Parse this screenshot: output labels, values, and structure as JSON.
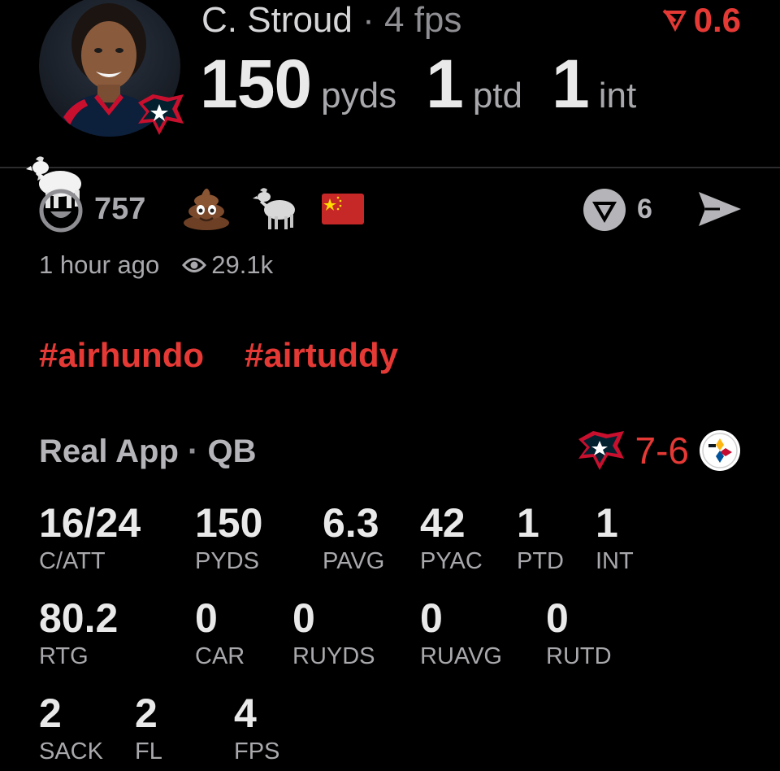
{
  "player": {
    "name": "C. Stroud",
    "separator": "·",
    "fps_label": "4 fps",
    "change_value": "0.6",
    "change_direction": "down",
    "headline": [
      {
        "value": "150",
        "unit": "pyds"
      },
      {
        "value": "1",
        "unit": "ptd"
      },
      {
        "value": "1",
        "unit": "int"
      }
    ]
  },
  "reactions": {
    "count": "757",
    "icons": [
      "goat-icon",
      "smiley-icon",
      "poop-icon",
      "goat-icon",
      "china-flag-icon"
    ],
    "comments_count": "6"
  },
  "meta": {
    "time_ago": "1 hour ago",
    "views": "29.1k"
  },
  "hashtags": [
    "#airhundo",
    "#airtuddy"
  ],
  "stats_section": {
    "title": "Real App",
    "separator": "·",
    "position": "QB",
    "score": "7-6",
    "away_team_icon": "texans-logo-icon",
    "home_team_icon": "steelers-logo-icon",
    "rows": [
      [
        {
          "value": "16/24",
          "label": "C/ATT"
        },
        {
          "value": "150",
          "label": "PYDS"
        },
        {
          "value": "6.3",
          "label": "PAVG"
        },
        {
          "value": "42",
          "label": "PYAC"
        },
        {
          "value": "1",
          "label": "PTD"
        },
        {
          "value": "1",
          "label": "INT"
        }
      ],
      [
        {
          "value": "80.2",
          "label": "RTG"
        },
        {
          "value": "0",
          "label": "CAR"
        },
        {
          "value": "0",
          "label": "RUYDS"
        },
        {
          "value": "0",
          "label": "RUAVG"
        },
        {
          "value": "0",
          "label": "RUTD"
        }
      ],
      [
        {
          "value": "2",
          "label": "SACK"
        },
        {
          "value": "2",
          "label": "FL"
        },
        {
          "value": "4",
          "label": "FPS"
        }
      ]
    ]
  },
  "colors": {
    "accent_red": "#e53935",
    "background": "#000000",
    "text_primary": "#e9e9ea",
    "text_secondary": "#a9a9ad"
  }
}
